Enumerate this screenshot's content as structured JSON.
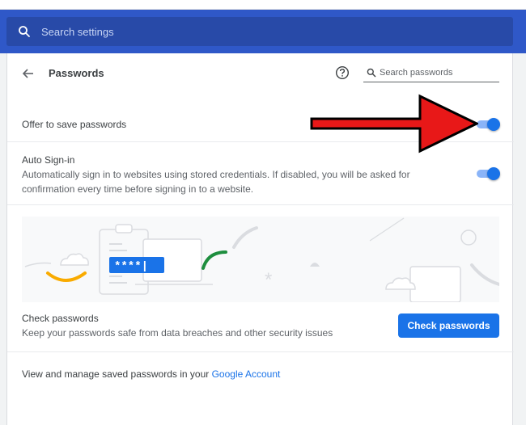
{
  "header": {
    "search_placeholder": "Search settings"
  },
  "page": {
    "title": "Passwords",
    "search_placeholder": "Search passwords"
  },
  "offer_save": {
    "label": "Offer to save passwords",
    "enabled": true
  },
  "auto_signin": {
    "label": "Auto Sign-in",
    "description": "Automatically sign in to websites using stored credentials. If disabled, you will be asked for confirmation every time before signing in to a website.",
    "enabled": true
  },
  "illustration": {
    "masked_text": "****|"
  },
  "check_passwords": {
    "label": "Check passwords",
    "description": "Keep your passwords safe from data breaches and other security issues",
    "button_label": "Check passwords"
  },
  "manage": {
    "text": "View and manage saved passwords in your ",
    "link_text": "Google Account"
  },
  "colors": {
    "header_blue": "#2f58c8",
    "accent_blue": "#1a73e8",
    "toggle_track": "#8ab4f8",
    "annotation_arrow": "#e81818"
  }
}
